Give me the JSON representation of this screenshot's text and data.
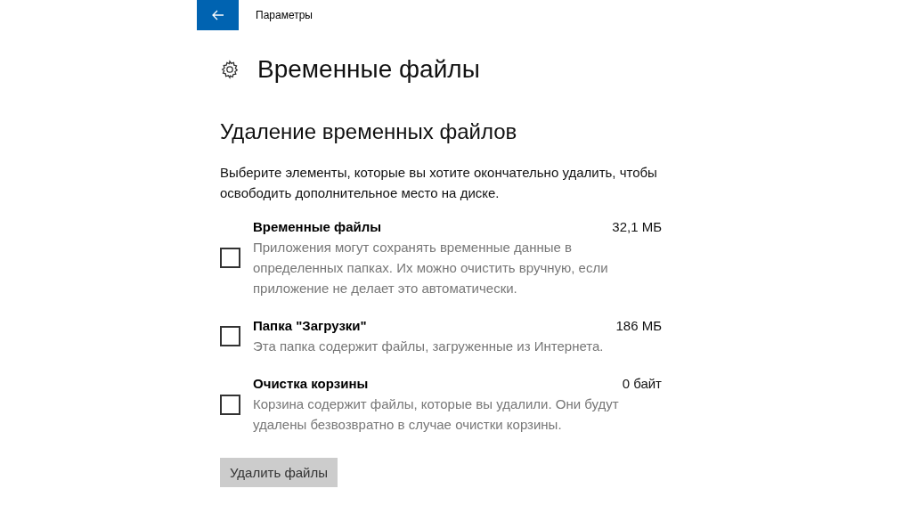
{
  "window": {
    "title": "Параметры"
  },
  "page": {
    "title": "Временные файлы"
  },
  "section": {
    "heading": "Удаление временных файлов",
    "description": "Выберите элементы, которые вы хотите окончательно удалить, чтобы освободить дополнительное место на диске."
  },
  "items": [
    {
      "name": "Временные файлы",
      "size": "32,1 МБ",
      "description": "Приложения могут сохранять временные данные в определенных папках. Их можно очистить вручную, если приложение не делает это автоматически.",
      "checked": false
    },
    {
      "name": "Папка \"Загрузки\"",
      "size": "186 МБ",
      "description": "Эта папка содержит файлы, загруженные из Интернета.",
      "checked": false
    },
    {
      "name": "Очистка корзины",
      "size": "0 байт",
      "description": "Корзина содержит файлы, которые вы удалили. Они будут удалены безвозвратно в случае очистки корзины.",
      "checked": false
    }
  ],
  "button": {
    "label": "Удалить файлы",
    "disabled": true
  }
}
